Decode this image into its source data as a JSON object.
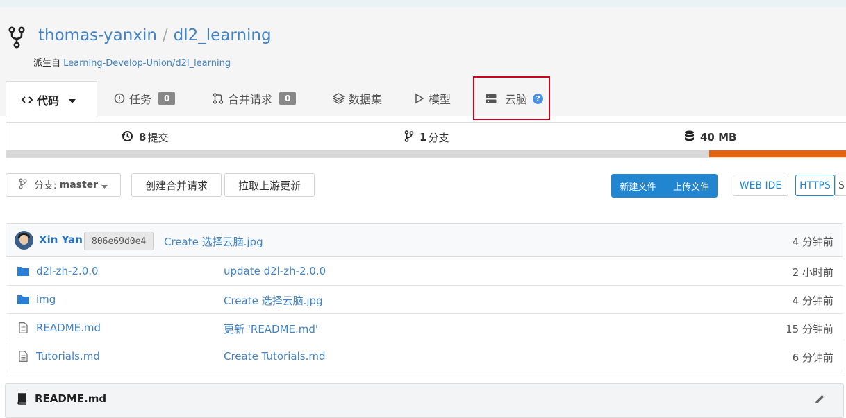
{
  "repo": {
    "owner": "thomas-yanxin",
    "separator": "/",
    "name": "dl2_learning",
    "forked_label": "派生自",
    "forked_from": "Learning-Develop-Union/d2l_learning"
  },
  "tabs": [
    {
      "label": "代码",
      "active": true
    },
    {
      "label": "任务",
      "count": "0"
    },
    {
      "label": "合并请求",
      "count": "0"
    },
    {
      "label": "数据集"
    },
    {
      "label": "模型"
    },
    {
      "label": "云脑"
    }
  ],
  "stats": {
    "commits_count": "8",
    "commits_label": "提交",
    "branches_count": "1",
    "branches_label": "分支",
    "size": "40 MB"
  },
  "toolbar": {
    "branch_label": "分支:",
    "branch_value": "master",
    "create_pr": "创建合并请求",
    "pull_upstream": "拉取上游更新",
    "new_file": "新建文件",
    "upload_file": "上传文件",
    "web_ide": "WEB IDE",
    "https": "HTTPS",
    "ssh_partial": "S"
  },
  "latest_commit": {
    "author": "Xin Yan",
    "sha": "806e69d0e4",
    "message": "Create 选择云脑.jpg",
    "time": "4 分钟前"
  },
  "files": [
    {
      "name": "d2l-zh-2.0.0",
      "type": "folder",
      "message": "update d2l-zh-2.0.0",
      "time": "2 小时前"
    },
    {
      "name": "img",
      "type": "folder",
      "message": "Create 选择云脑.jpg",
      "time": "4 分钟前"
    },
    {
      "name": "README.md",
      "type": "file",
      "message": "更新 'README.md'",
      "time": "15 分钟前"
    },
    {
      "name": "Tutorials.md",
      "type": "file",
      "message": "Create Tutorials.md",
      "time": "6 分钟前"
    }
  ],
  "readme": {
    "title": "README.md"
  },
  "colors": {
    "accent": "#2185d0",
    "language_bar": "#e06412",
    "highlight": "#d0021b"
  }
}
